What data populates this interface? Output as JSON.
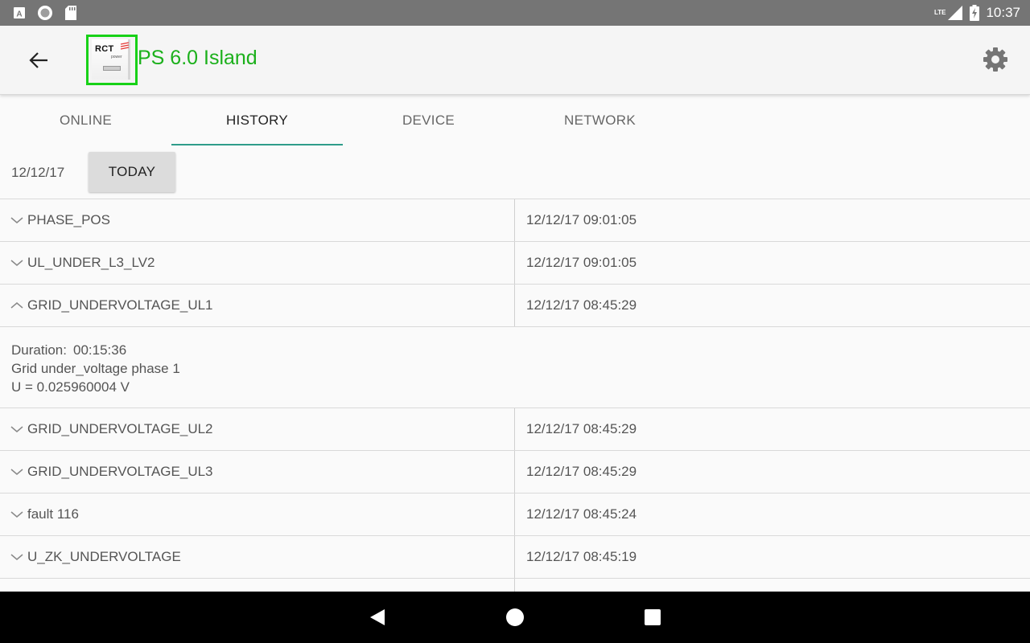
{
  "status_bar": {
    "network_type": "LTE",
    "time": "10:37",
    "icons": [
      "a-notification-icon",
      "circle-notification-icon",
      "sd-card-icon",
      "signal-icon",
      "battery-icon"
    ]
  },
  "app_bar": {
    "logo_text": "RCT",
    "logo_subtext": "power",
    "title": "PS 6.0 Island",
    "title_color": "#1bb01b",
    "logo_border_color": "#17d117"
  },
  "tabs": [
    {
      "label": "ONLINE",
      "active": false
    },
    {
      "label": "HISTORY",
      "active": true
    },
    {
      "label": "DEVICE",
      "active": false
    },
    {
      "label": "NETWORK",
      "active": false
    }
  ],
  "accent_color": "#2e9c8a",
  "date_row": {
    "date": "12/12/17",
    "today_label": "TODAY"
  },
  "events": [
    {
      "name": "PHASE_POS",
      "time": "12/12/17 09:01:05",
      "expanded": false
    },
    {
      "name": "UL_UNDER_L3_LV2",
      "time": "12/12/17 09:01:05",
      "expanded": false
    },
    {
      "name": "GRID_UNDERVOLTAGE_UL1",
      "time": "12/12/17 08:45:29",
      "expanded": true
    },
    {
      "name": "GRID_UNDERVOLTAGE_UL2",
      "time": "12/12/17 08:45:29",
      "expanded": false
    },
    {
      "name": "GRID_UNDERVOLTAGE_UL3",
      "time": "12/12/17 08:45:29",
      "expanded": false
    },
    {
      "name": "fault 116",
      "time": "12/12/17 08:45:24",
      "expanded": false
    },
    {
      "name": "U_ZK_UNDERVOLTAGE",
      "time": "12/12/17 08:45:19",
      "expanded": false
    }
  ],
  "expanded_detail": {
    "duration_label": "Duration:",
    "duration_value": "00:15:36",
    "description": "Grid under_voltage phase 1",
    "value_line": "U = 0.025960004 V"
  }
}
